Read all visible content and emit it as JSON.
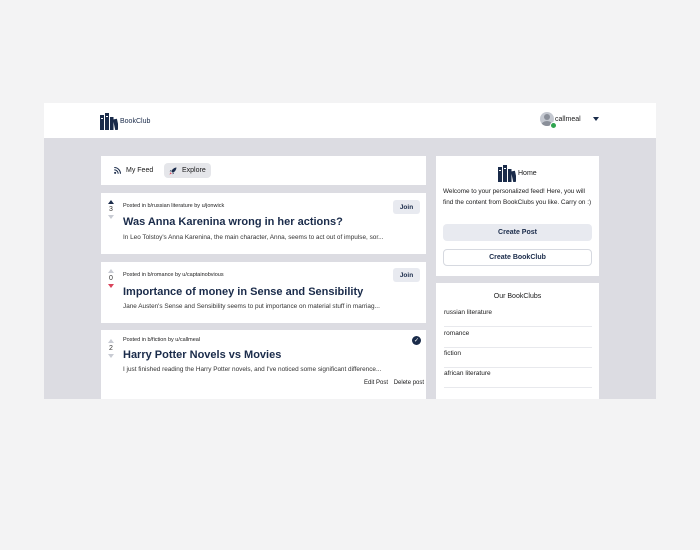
{
  "header": {
    "logo_text": "BookClub",
    "username": "callmeal"
  },
  "tabs": [
    {
      "label": "My Feed",
      "icon": "rss-icon"
    },
    {
      "label": "Explore",
      "icon": "rocket-icon"
    }
  ],
  "posts": [
    {
      "votes": "3",
      "vote_state": "up",
      "meta": "Posted in b/russian literature by u/jonwick",
      "title": "Was Anna Karenina wrong in her actions?",
      "excerpt": "In Leo Tolstoy's Anna Karenina, the main character, Anna, seems to act out of impulse, sor...",
      "action": "Join"
    },
    {
      "votes": "0",
      "vote_state": "down",
      "meta": "Posted in b/romance by u/captainobvious",
      "title": "Importance of money in Sense and Sensibility",
      "excerpt": "Jane Austen's Sense and Sensibility seems to put importance on material stuff in marriag...",
      "action": "Join"
    },
    {
      "votes": "2",
      "vote_state": "none",
      "meta": "Posted in b/fiction by u/callmeal",
      "title": "Harry Potter Novels vs Movies",
      "excerpt": "I just finished reading the Harry Potter novels, and I've noticed some significant difference...",
      "edit_label": "Edit Post",
      "delete_label": "Delete post"
    }
  ],
  "sidebar": {
    "home_label": "Home",
    "welcome": "Welcome to your personalized feed! Here, you will find the content from BookClubs you like. Carry on :)",
    "create_post": "Create Post",
    "create_bookclub": "Create BookClub"
  },
  "clubs": {
    "title": "Our BookClubs",
    "items": [
      "russian literature",
      "romance",
      "fiction",
      "african literature"
    ]
  },
  "colors": {
    "brand": "#1a2b4a",
    "downvote": "#d9435a",
    "online": "#2fa44f"
  }
}
